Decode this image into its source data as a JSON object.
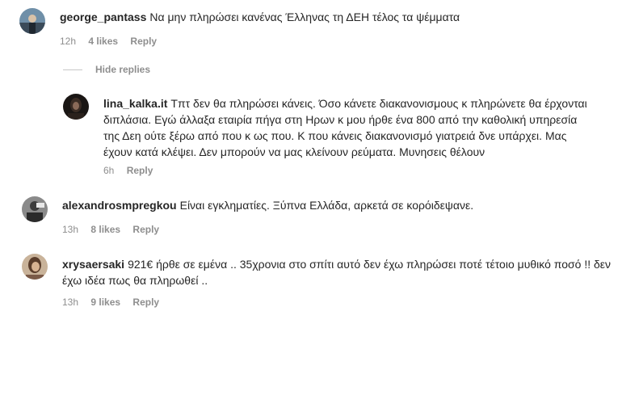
{
  "comments": [
    {
      "username": "george_pantass",
      "text": "Να μην πληρώσει κανένας Έλληνας τη ΔΕΗ τέλος τα ψέμματα",
      "time": "12h",
      "likes": "4 likes",
      "reply": "Reply"
    },
    {
      "username": "lina_kalka.it",
      "text": "Τπτ δεν θα πληρώσει κάνεις. Όσο κάνετε διακανονισμους κ πληρώνετε θα έρχονται διπλάσια. Εγώ άλλαξα εταιρία πήγα στη Ηρων κ μου ήρθε ένα 800 από την καθολική υπηρεσία της Δεη ούτε ξέρω από που κ ως που. Κ που κάνεις διακανονισμό γιατρειά δνε υπάρχει. Μας έχουν κατά κλέψει. Δεν μπορούν να μας κλείνουν ρεύματα. Μυνησεις θέλουν",
      "time": "6h",
      "reply": "Reply"
    },
    {
      "username": "alexandrosmpregkou",
      "text": "Είναι εγκληματίες. Ξύπνα Ελλάδα, αρκετά σε κορόιδεψανε.",
      "time": "13h",
      "likes": "8 likes",
      "reply": "Reply"
    },
    {
      "username": "xrysaersaki",
      "text": "921€ ήρθε σε εμένα .. 35χρονια στο σπίτι αυτό δεν έχω πληρώσει ποτέ τέτοιο μυθικό ποσό !! δεν έχω ιδέα πως θα πληρωθεί ..",
      "time": "13h",
      "likes": "9 likes",
      "reply": "Reply"
    }
  ],
  "hide_replies": "Hide replies"
}
